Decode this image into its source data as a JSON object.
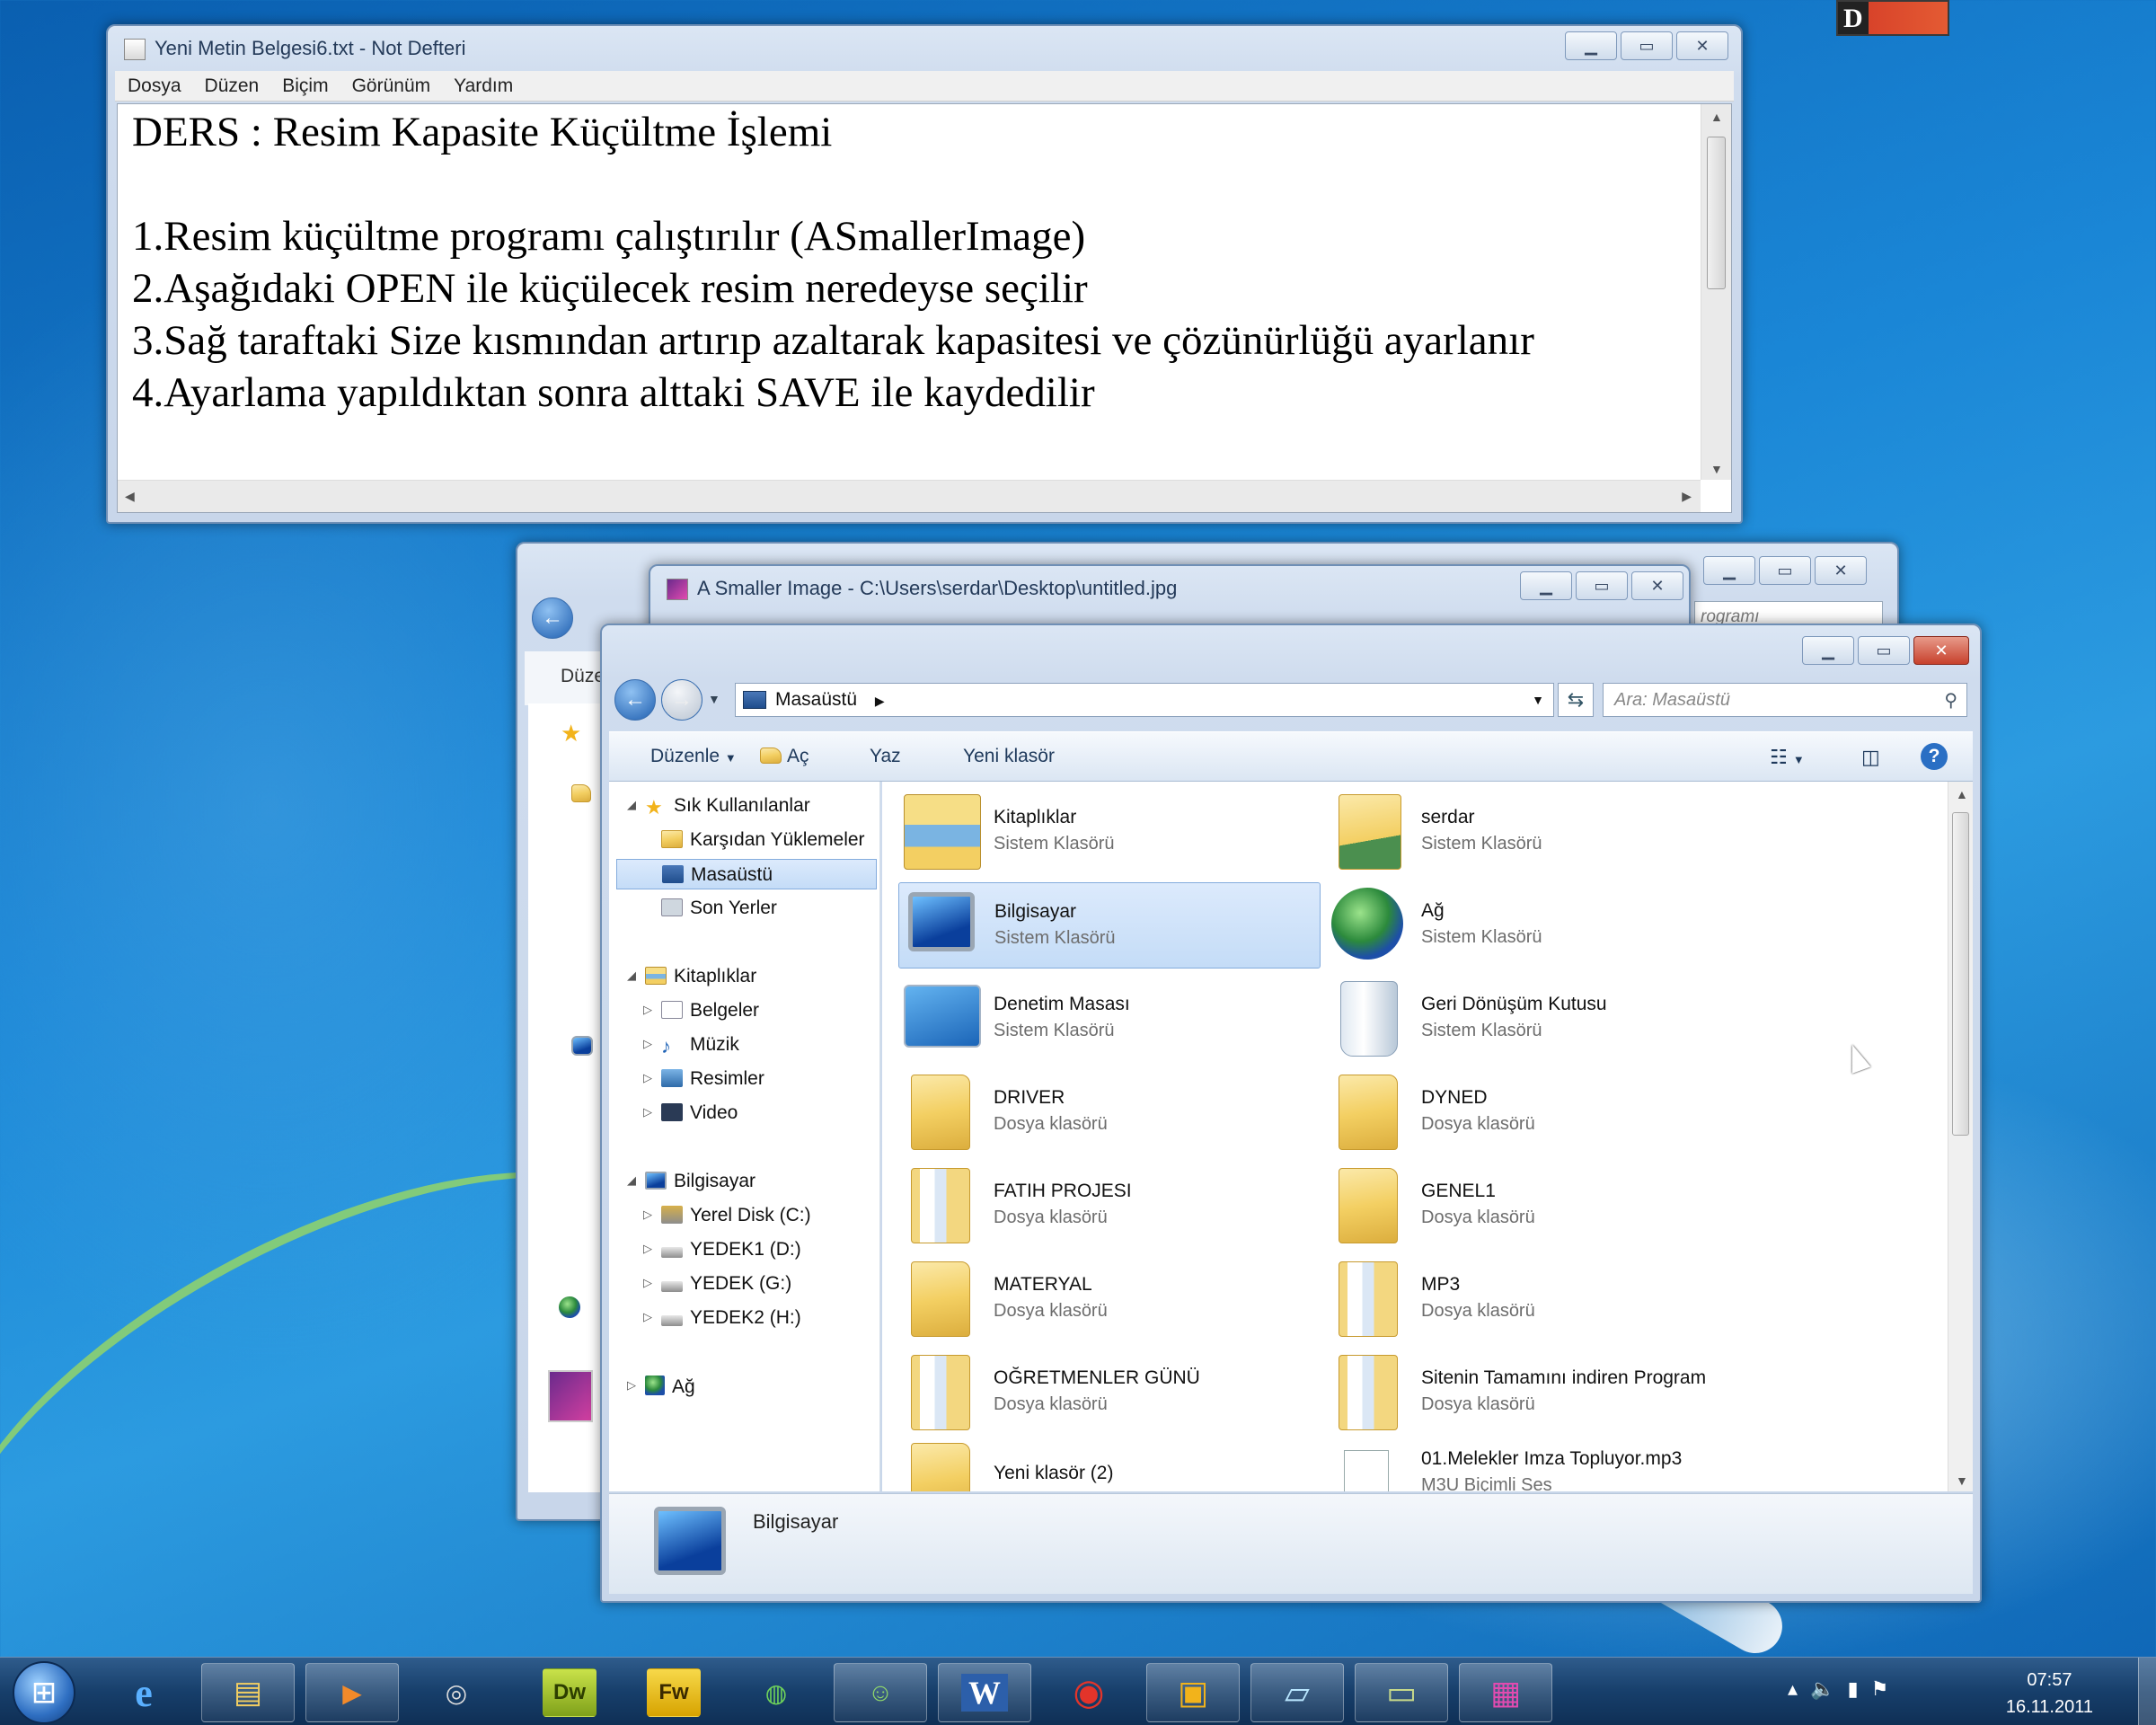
{
  "notepad": {
    "title": "Yeni Metin Belgesi6.txt - Not Defteri",
    "menu": [
      "Dosya",
      "Düzen",
      "Biçim",
      "Görünüm",
      "Yardım"
    ],
    "content": "DERS : Resim Kapasite Küçültme İşlemi\n\n1.Resim küçültme programı çalıştırılır (ASmallerImage)\n2.Aşağıdaki OPEN ile küçülecek resim neredeyse seçilir\n3.Sağ taraftaki Size kısmından artırıp azaltarak kapasitesi ve çözünürlüğü ayarlanır\n4.Ayarlama yapıldıktan sonra alttaki SAVE ile kaydedilir"
  },
  "back_window": {
    "toolbar_fragment": "Düze",
    "search_fragment": "rogramı"
  },
  "asmaller": {
    "title": "A Smaller Image - C:\\Users\\serdar\\Desktop\\untitled.jpg"
  },
  "explorer": {
    "address": "Masaüstü",
    "search_placeholder": "Ara: Masaüstü",
    "commands": {
      "organize": "Düzenle",
      "open": "Aç",
      "write": "Yaz",
      "new_folder": "Yeni klasör"
    },
    "nav": [
      {
        "label": "Sık Kullanılanlar",
        "icon": "star-icon"
      },
      {
        "label": "Karşıdan Yüklemeler",
        "icon": "downloads-icon"
      },
      {
        "label": "Masaüstü",
        "icon": "desktop-icon"
      },
      {
        "label": "Son Yerler",
        "icon": "recent-places-icon"
      },
      {
        "label": "Kitaplıklar",
        "icon": "libraries-icon"
      },
      {
        "label": "Belgeler",
        "icon": "documents-icon"
      },
      {
        "label": "Müzik",
        "icon": "music-icon"
      },
      {
        "label": "Resimler",
        "icon": "pictures-icon"
      },
      {
        "label": "Video",
        "icon": "video-icon"
      },
      {
        "label": "Bilgisayar",
        "icon": "computer-icon"
      },
      {
        "label": "Yerel Disk (C:)",
        "icon": "drive-icon"
      },
      {
        "label": "YEDEK1 (D:)",
        "icon": "drive-icon"
      },
      {
        "label": "YEDEK (G:)",
        "icon": "drive-icon"
      },
      {
        "label": "YEDEK2 (H:)",
        "icon": "drive-icon"
      },
      {
        "label": "Ağ",
        "icon": "network-icon"
      }
    ],
    "items": [
      {
        "name": "Kitaplıklar",
        "type": "Sistem Klasörü",
        "icon": "libraries-icon"
      },
      {
        "name": "serdar",
        "type": "Sistem Klasörü",
        "icon": "user-folder-icon"
      },
      {
        "name": "Bilgisayar",
        "type": "Sistem Klasörü",
        "icon": "computer-icon"
      },
      {
        "name": "Ağ",
        "type": "Sistem Klasörü",
        "icon": "network-icon"
      },
      {
        "name": "Denetim Masası",
        "type": "Sistem Klasörü",
        "icon": "control-panel-icon"
      },
      {
        "name": "Geri Dönüşüm Kutusu",
        "type": "Sistem Klasörü",
        "icon": "recycle-bin-icon"
      },
      {
        "name": "DRIVER",
        "type": "Dosya klasörü",
        "icon": "folder-icon"
      },
      {
        "name": "DYNED",
        "type": "Dosya klasörü",
        "icon": "folder-icon"
      },
      {
        "name": "FATIH PROJESI",
        "type": "Dosya klasörü",
        "icon": "folder-icon"
      },
      {
        "name": "GENEL1",
        "type": "Dosya klasörü",
        "icon": "folder-icon"
      },
      {
        "name": "MATERYAL",
        "type": "Dosya klasörü",
        "icon": "folder-icon"
      },
      {
        "name": "MP3",
        "type": "Dosya klasörü",
        "icon": "folder-icon"
      },
      {
        "name": "OĞRETMENLER GÜNÜ",
        "type": "Dosya klasörü",
        "icon": "folder-icon"
      },
      {
        "name": "Sitenin Tamamını indiren Program",
        "type": "Dosya klasörü",
        "icon": "folder-icon"
      },
      {
        "name": "Yeni klasör (2)",
        "type": "",
        "icon": "folder-icon"
      },
      {
        "name": "01.Melekler Imza Topluyor.mp3",
        "type": "M3U Biçimli Ses",
        "icon": "audio-file-icon"
      }
    ],
    "selected": "Bilgisayar",
    "details_label": "Bilgisayar"
  },
  "corner_widget": {
    "letter": "D"
  },
  "taskbar": {
    "apps": [
      {
        "name": "Internet Explorer",
        "icon": "ie-icon",
        "glyph": "e"
      },
      {
        "name": "Explorer",
        "icon": "explorer-icon",
        "glyph": "▤"
      },
      {
        "name": "Media Player",
        "icon": "media-player-icon",
        "glyph": "▶"
      },
      {
        "name": "App",
        "icon": "app-icon",
        "glyph": "◎"
      },
      {
        "name": "Dreamweaver",
        "icon": "dreamweaver-icon",
        "glyph": "Dw"
      },
      {
        "name": "Fireworks",
        "icon": "fireworks-icon",
        "glyph": "Fw"
      },
      {
        "name": "Globe",
        "icon": "globe-app-icon",
        "glyph": "◍"
      },
      {
        "name": "Users",
        "icon": "users-app-icon",
        "glyph": "☺"
      },
      {
        "name": "Word",
        "icon": "word-icon",
        "glyph": "W"
      },
      {
        "name": "Red App",
        "icon": "red-app-icon",
        "glyph": "◉"
      },
      {
        "name": "Blue App",
        "icon": "blue-app-icon",
        "glyph": "▣"
      },
      {
        "name": "Notepad",
        "icon": "notepad-icon",
        "glyph": "▱"
      },
      {
        "name": "Green App",
        "icon": "green-app-icon",
        "glyph": "▭"
      },
      {
        "name": "ASmallerImage",
        "icon": "asmaller-image-icon",
        "glyph": "▦"
      }
    ],
    "time": "07:57",
    "date": "16.11.2011"
  }
}
